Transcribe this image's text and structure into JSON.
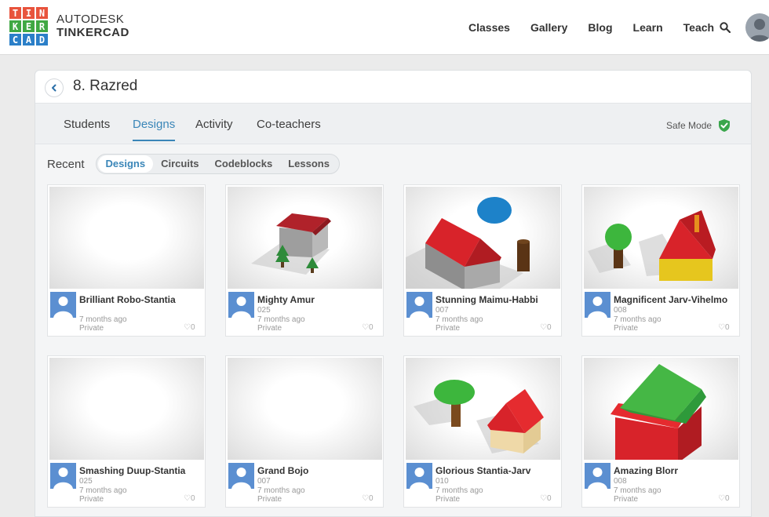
{
  "header": {
    "logo_letters": [
      "T",
      "I",
      "N",
      "K",
      "E",
      "R",
      "C",
      "A",
      "D"
    ],
    "logo_colors": [
      "#e8533c",
      "#e8533c",
      "#e8533c",
      "#40a843",
      "#40a843",
      "#40a843",
      "#2b7fc8",
      "#2b7fc8",
      "#2b7fc8"
    ],
    "brand_top": "AUTODESK",
    "brand_bottom": "TINKERCAD",
    "nav": [
      "Classes",
      "Gallery",
      "Blog",
      "Learn",
      "Teach"
    ]
  },
  "panel": {
    "title": "8. Razred",
    "tabs": [
      "Students",
      "Designs",
      "Activity",
      "Co-teachers"
    ],
    "active_tab": "Designs",
    "safe_mode_label": "Safe Mode",
    "recent_label": "Recent",
    "filters": [
      "Designs",
      "Circuits",
      "Codeblocks",
      "Lessons"
    ],
    "active_filter": "Designs"
  },
  "designs": [
    {
      "name": "Brilliant Robo-Stantia",
      "code": "",
      "time": "7 months ago",
      "privacy": "Private",
      "likes": "0",
      "thumb": "empty"
    },
    {
      "name": "Mighty Amur",
      "code": "025",
      "time": "7 months ago",
      "privacy": "Private",
      "likes": "0",
      "thumb": "house-gray"
    },
    {
      "name": "Stunning Maimu-Habbi",
      "code": "007",
      "time": "7 months ago",
      "privacy": "Private",
      "likes": "0",
      "thumb": "house-red"
    },
    {
      "name": "Magnificent Jarv-Vihelmo",
      "code": "008",
      "time": "7 months ago",
      "privacy": "Private",
      "likes": "0",
      "thumb": "house-yellow"
    },
    {
      "name": "Smashing Duup-Stantia",
      "code": "025",
      "time": "7 months ago",
      "privacy": "Private",
      "likes": "0",
      "thumb": "empty"
    },
    {
      "name": "Grand Bojo",
      "code": "007",
      "time": "7 months ago",
      "privacy": "Private",
      "likes": "0",
      "thumb": "empty"
    },
    {
      "name": "Glorious Stantia-Jarv",
      "code": "010",
      "time": "7 months ago",
      "privacy": "Private",
      "likes": "0",
      "thumb": "house-beige"
    },
    {
      "name": "Amazing Blorr",
      "code": "008",
      "time": "7 months ago",
      "privacy": "Private",
      "likes": "0",
      "thumb": "house-green"
    }
  ],
  "colors": {
    "accent": "#3a86b8",
    "safe": "#3aa64c",
    "avatar": "#5b8fd1"
  }
}
